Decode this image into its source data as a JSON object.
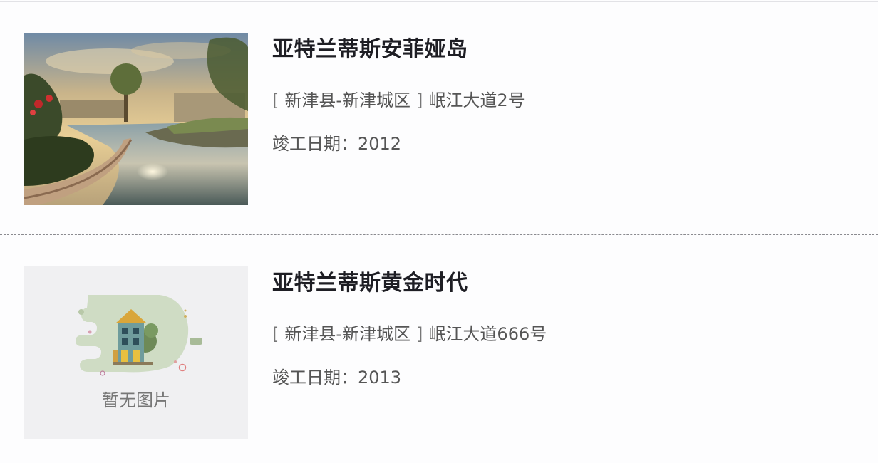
{
  "listings": [
    {
      "name": "亚特兰蒂斯安菲娅岛",
      "district": "新津县-新津城区",
      "street": "岷江大道2号",
      "completed_label": "竣工日期：",
      "completed_year": "2012",
      "image": "resort-pool-photo"
    },
    {
      "name": "亚特兰蒂斯黄金时代",
      "district": "新津县-新津城区",
      "street": "岷江大道666号",
      "completed_label": "竣工日期：",
      "completed_year": "2013",
      "image": "no-image-placeholder",
      "no_image_text": "暂无图片"
    }
  ],
  "brackets": {
    "open": "[",
    "close": "]"
  }
}
